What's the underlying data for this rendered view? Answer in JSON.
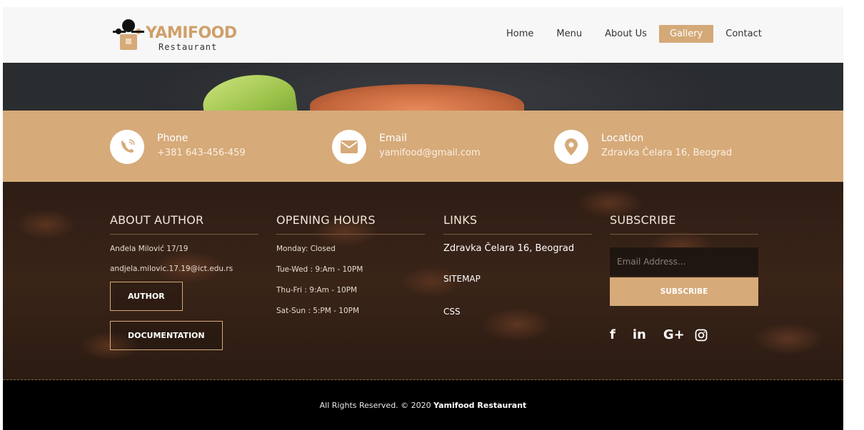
{
  "logo": {
    "name": "YAMIFOOD",
    "subtitle": "Restaurant"
  },
  "nav": {
    "items": [
      {
        "label": "Home"
      },
      {
        "label": "Menu"
      },
      {
        "label": "About Us"
      },
      {
        "label": "Gallery",
        "active": true
      },
      {
        "label": "Contact"
      }
    ]
  },
  "contact": {
    "phone": {
      "title": "Phone",
      "value": "+381 643-456-459",
      "icon": "phone-icon"
    },
    "email": {
      "title": "Email",
      "value": "yamifood@gmail.com",
      "icon": "envelope-icon"
    },
    "location": {
      "title": "Location",
      "value": "Zdravka Čelara 16, Beograd",
      "icon": "map-pin-icon"
    }
  },
  "about": {
    "title": "ABOUT AUTHOR",
    "name": "Anđela Milović 17/19",
    "email": "andjela.milovic.17.19@ict.edu.rs",
    "author_button": "AUTHOR",
    "documentation_button": "DOCUMENTATION"
  },
  "hours": {
    "title": "OPENING HOURS",
    "lines": [
      "Monday: Closed",
      "Tue-Wed : 9:Am - 10PM",
      "Thu-Fri : 9:Am - 10PM",
      "Sat-Sun : 5:PM - 10PM"
    ]
  },
  "links": {
    "title": "LINKS",
    "items": [
      "Zdravka Čelara 16, Beograd",
      "SITEMAP",
      "CSS"
    ]
  },
  "subscribe": {
    "title": "SUBSCRIBE",
    "placeholder": "Email Address...",
    "button": "SUBSCRIBE",
    "social": [
      "f",
      "in",
      "G+"
    ]
  },
  "footer": {
    "copyright": "All Rights Reserved. © 2020 ",
    "brand": "Yamifood Restaurant"
  },
  "colors": {
    "accent": "#d6aa79",
    "header_bg": "#f7f7f8",
    "bottom_bg": "#000000"
  }
}
